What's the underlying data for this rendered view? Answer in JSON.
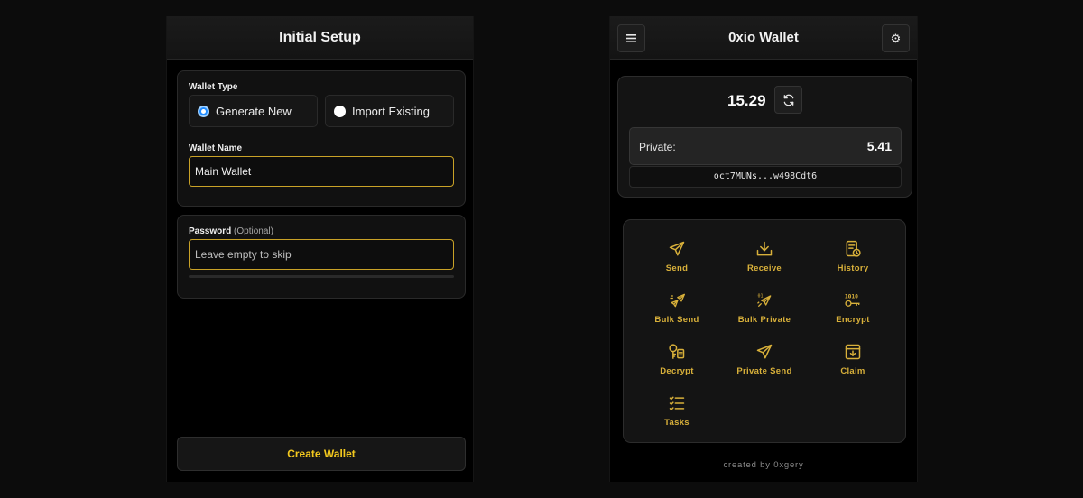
{
  "setup": {
    "title": "Initial Setup",
    "wallet_type_label": "Wallet Type",
    "options": [
      "Generate New",
      "Import Existing"
    ],
    "selected_option": "Generate New",
    "wallet_name_label": "Wallet Name",
    "wallet_name_value": "Main Wallet",
    "password_label": "Password",
    "password_optional": "(Optional)",
    "password_placeholder": "Leave empty to skip",
    "create_button": "Create Wallet"
  },
  "wallet": {
    "title": "0xio Wallet",
    "balance": "15.29",
    "private_label": "Private:",
    "private_value": "5.41",
    "address": "oct7MUNs...w498Cdt6",
    "actions": [
      {
        "label": "Send",
        "icon": "send-icon"
      },
      {
        "label": "Receive",
        "icon": "receive-icon"
      },
      {
        "label": "History",
        "icon": "history-icon"
      },
      {
        "label": "Bulk Send",
        "icon": "bulk-send-icon"
      },
      {
        "label": "Bulk Private",
        "icon": "bulk-private-icon"
      },
      {
        "label": "Encrypt",
        "icon": "encrypt-icon"
      },
      {
        "label": "Decrypt",
        "icon": "decrypt-icon"
      },
      {
        "label": "Private Send",
        "icon": "private-send-icon"
      },
      {
        "label": "Claim",
        "icon": "claim-icon"
      },
      {
        "label": "Tasks",
        "icon": "tasks-icon"
      }
    ],
    "footer": "created by 0xgery"
  },
  "colors": {
    "accent_gold": "#d8b03a",
    "input_border": "#c9a227",
    "button_text": "#f2c81e",
    "radio_selected": "#1f8bff"
  }
}
